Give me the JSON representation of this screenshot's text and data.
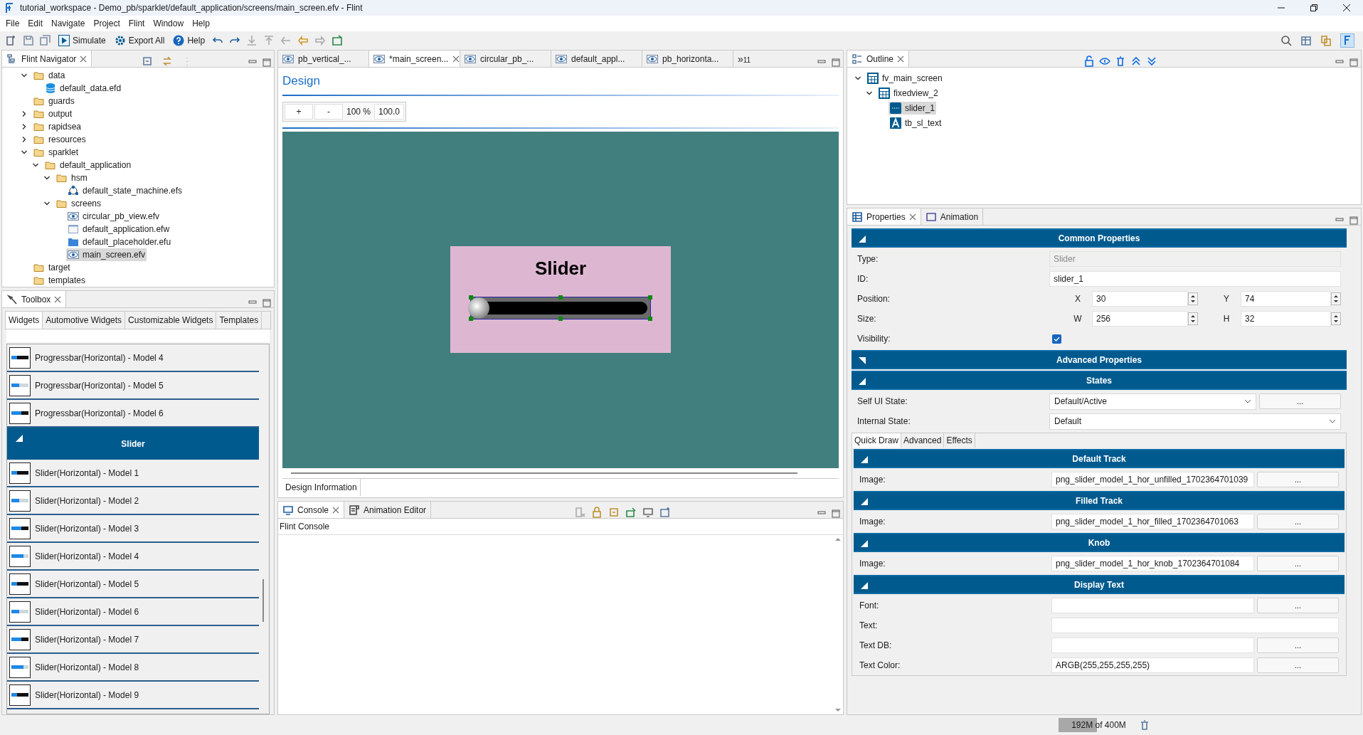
{
  "window": {
    "title": "tutorial_workspace - Demo_pb/sparklet/default_application/screens/main_screen.efv - Flint"
  },
  "menu": [
    "File",
    "Edit",
    "Navigate",
    "Project",
    "Flint",
    "Window",
    "Help"
  ],
  "toolbar": {
    "buttons": [
      {
        "kind": "simulate",
        "label": "Simulate"
      },
      {
        "kind": "export",
        "label": "Export All"
      },
      {
        "kind": "help",
        "label": "Help"
      }
    ]
  },
  "navigator": {
    "title": "Flint Navigator",
    "tree": [
      {
        "label": "data",
        "kind": "folder",
        "expanded": true,
        "selected": false,
        "children": [
          {
            "label": "default_data.efd",
            "kind": "database",
            "selected": false
          }
        ]
      },
      {
        "label": "guards",
        "kind": "folder",
        "selected": false
      },
      {
        "label": "output",
        "kind": "folder",
        "expanded": false,
        "selected": false
      },
      {
        "label": "rapidsea",
        "kind": "folder",
        "expanded": false,
        "selected": false
      },
      {
        "label": "resources",
        "kind": "folder",
        "expanded": false,
        "selected": false
      },
      {
        "label": "sparklet",
        "kind": "folder",
        "expanded": true,
        "selected": false,
        "children": [
          {
            "label": "default_application",
            "kind": "folder",
            "expanded": true,
            "selected": false,
            "children": [
              {
                "label": "hsm",
                "kind": "folder",
                "expanded": true,
                "selected": false,
                "children": [
                  {
                    "label": "default_state_machine.efs",
                    "kind": "statemachine",
                    "selected": false
                  }
                ]
              },
              {
                "label": "screens",
                "kind": "folder",
                "expanded": true,
                "selected": false,
                "children": [
                  {
                    "label": "circular_pb_view.efv",
                    "kind": "view",
                    "selected": false
                  },
                  {
                    "label": "default_application.efw",
                    "kind": "window",
                    "selected": false
                  },
                  {
                    "label": "default_placeholder.efu",
                    "kind": "placeholder",
                    "selected": false
                  },
                  {
                    "label": "main_screen.efv",
                    "kind": "view",
                    "selected": true
                  }
                ]
              }
            ]
          }
        ]
      },
      {
        "label": "target",
        "kind": "folder",
        "selected": false
      },
      {
        "label": "templates",
        "kind": "folder",
        "selected": false
      }
    ]
  },
  "toolbox": {
    "title": "Toolbox",
    "tabs": [
      {
        "label": "Widgets",
        "selected": true
      },
      {
        "label": "Automotive Widgets",
        "selected": false
      },
      {
        "label": "Customizable Widgets",
        "selected": false
      },
      {
        "label": "Templates",
        "selected": false
      }
    ],
    "items": [
      {
        "kind": "item",
        "label": "Progressbar(Horizontal) - Model 4"
      },
      {
        "kind": "item",
        "label": "Progressbar(Horizontal) - Model 5"
      },
      {
        "kind": "item",
        "label": "Progressbar(Horizontal) - Model 6"
      },
      {
        "kind": "header",
        "label": "Slider",
        "expanded": true
      },
      {
        "kind": "item",
        "label": "Slider(Horizontal) - Model 1"
      },
      {
        "kind": "item",
        "label": "Slider(Horizontal) - Model 2"
      },
      {
        "kind": "item",
        "label": "Slider(Horizontal) - Model 3"
      },
      {
        "kind": "item",
        "label": "Slider(Horizontal) - Model 4"
      },
      {
        "kind": "item",
        "label": "Slider(Horizontal) - Model 5"
      },
      {
        "kind": "item",
        "label": "Slider(Horizontal) - Model 6"
      },
      {
        "kind": "item",
        "label": "Slider(Horizontal) - Model 7"
      },
      {
        "kind": "item",
        "label": "Slider(Horizontal) - Model 8"
      },
      {
        "kind": "item",
        "label": "Slider(Horizontal) - Model 9"
      }
    ]
  },
  "editor": {
    "tabs": [
      {
        "label": "pb_vertical_...",
        "selected": false
      },
      {
        "label": "*main_screen...",
        "selected": true
      },
      {
        "label": "circular_pb_...",
        "selected": false
      },
      {
        "label": "default_appl...",
        "selected": false
      },
      {
        "label": "pb_horizonta...",
        "selected": false
      }
    ],
    "overflow_mark": "»",
    "overflow_count": "11",
    "design": {
      "title": "Design",
      "zoom_buttons": [
        "+",
        "-"
      ],
      "zoom_percent": "100 %",
      "zoom_value": "100.0",
      "canvas": {
        "heading": "Slider",
        "slider": {
          "level": 0
        }
      }
    },
    "bottom_tab": "Design Information"
  },
  "console": {
    "tabs": [
      {
        "label": "Console",
        "selected": true
      },
      {
        "label": "Animation Editor",
        "selected": false
      }
    ],
    "title": "Flint Console"
  },
  "outline": {
    "title": "Outline",
    "tree": [
      {
        "label": "fv_main_screen",
        "kind": "view",
        "expanded": true,
        "selected": false,
        "children": [
          {
            "label": "fixedview_2",
            "kind": "view",
            "expanded": true,
            "selected": false,
            "children": [
              {
                "label": "slider_1",
                "kind": "slider",
                "selected": true
              },
              {
                "label": "tb_sl_text",
                "kind": "text",
                "selected": false
              }
            ]
          }
        ]
      }
    ]
  },
  "properties": {
    "tabs": [
      {
        "label": "Properties",
        "selected": true
      },
      {
        "label": "Animation",
        "selected": false
      }
    ],
    "sections": [
      {
        "title": "Common Properties",
        "expanded": true,
        "rows": [
          {
            "kind": "readonly",
            "label": "Type:",
            "value": "Slider"
          },
          {
            "kind": "text",
            "label": "ID:",
            "value": "slider_1"
          },
          {
            "kind": "pair",
            "label": "Position:",
            "a_label": "X",
            "a_value": "30",
            "b_label": "Y",
            "b_value": "74"
          },
          {
            "kind": "pair",
            "label": "Size:",
            "a_label": "W",
            "a_value": "256",
            "b_label": "H",
            "b_value": "32"
          },
          {
            "kind": "checkbox",
            "label": "Visibility:",
            "checked": true
          }
        ]
      },
      {
        "title": "Advanced Properties",
        "expanded": false
      },
      {
        "title": "States",
        "expanded": true,
        "rows": [
          {
            "kind": "select",
            "label": "Self UI State:",
            "value": "Default/Active",
            "button": "..."
          },
          {
            "kind": "select",
            "label": "Internal State:",
            "value": "Default"
          }
        ]
      }
    ],
    "sub_tabs": [
      {
        "label": "Quick Draw",
        "selected": true
      },
      {
        "label": "Advanced",
        "selected": false
      },
      {
        "label": "Effects",
        "selected": false
      }
    ],
    "sub_sections": [
      {
        "title": "Default Track",
        "expanded": true,
        "rows": [
          {
            "kind": "browse",
            "label": "Image:",
            "value": "png_slider_model_1_hor_unfilled_1702364701039",
            "button": "..."
          }
        ]
      },
      {
        "title": "Filled Track",
        "expanded": true,
        "rows": [
          {
            "kind": "browse",
            "label": "Image:",
            "value": "png_slider_model_1_hor_filled_1702364701063",
            "button": "..."
          }
        ]
      },
      {
        "title": "Knob",
        "expanded": true,
        "rows": [
          {
            "kind": "browse",
            "label": "Image:",
            "value": "png_slider_model_1_hor_knob_1702364701084",
            "button": "..."
          }
        ]
      },
      {
        "title": "Display Text",
        "expanded": true,
        "rows": [
          {
            "kind": "browse",
            "label": "Font:",
            "button": "..."
          },
          {
            "kind": "text",
            "label": "Text:"
          },
          {
            "kind": "browse",
            "label": "Text DB:",
            "button": "..."
          },
          {
            "kind": "browse",
            "label": "Text Color:",
            "value": "ARGB(255,255,255,255)",
            "button": "..."
          }
        ]
      }
    ]
  },
  "status_bar": {
    "memory": "192M of 400M",
    "level": 0.48
  }
}
